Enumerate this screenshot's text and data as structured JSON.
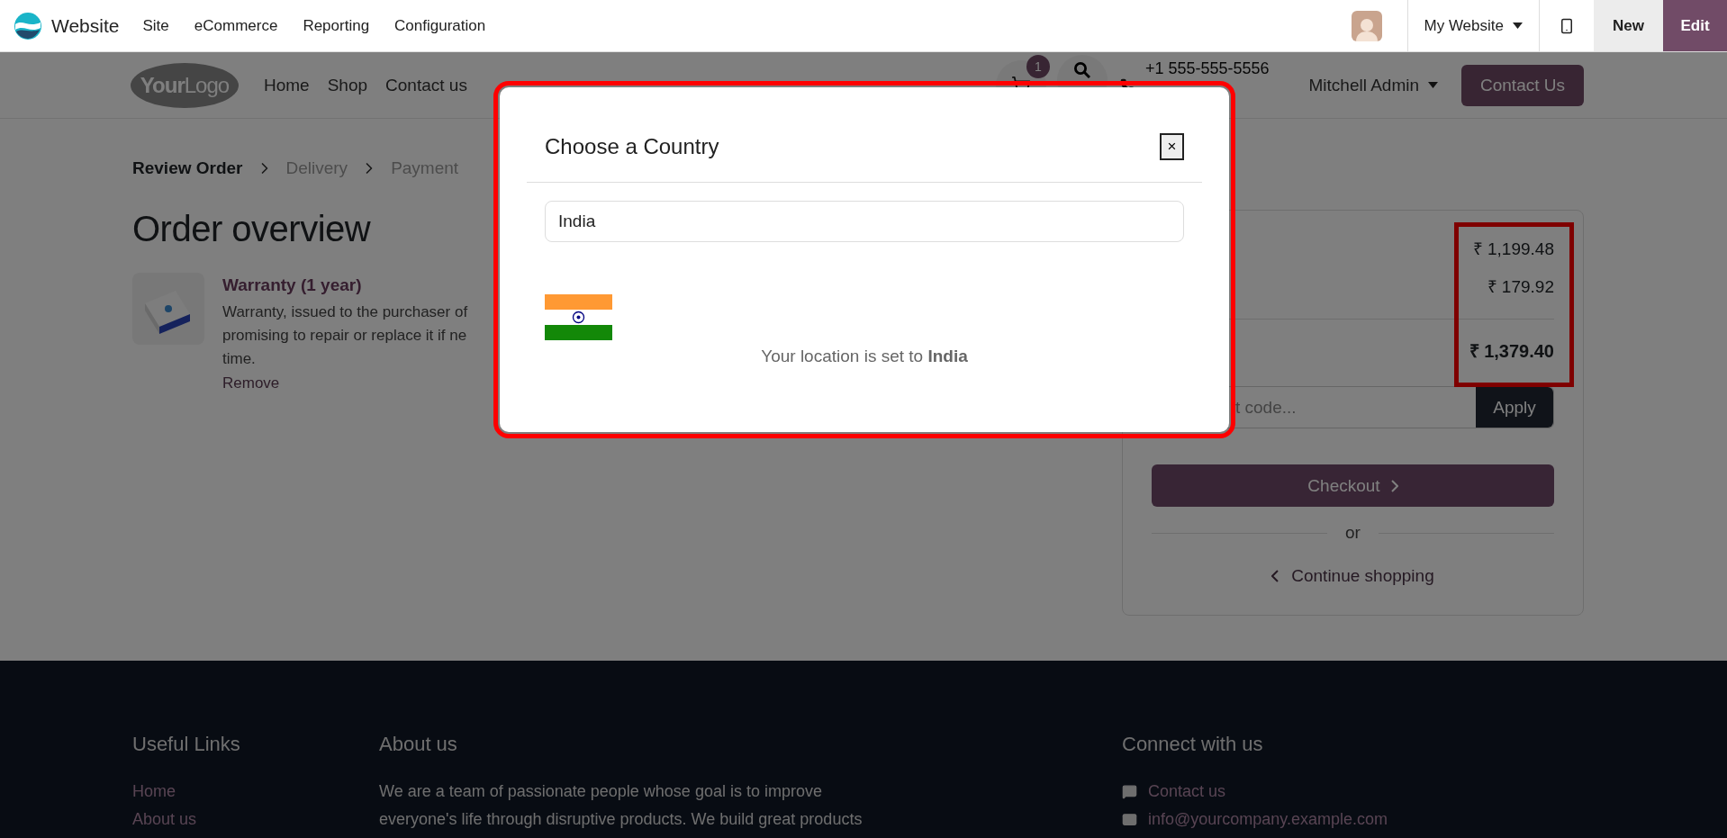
{
  "admin_bar": {
    "app": "Website",
    "menus": [
      "Site",
      "eCommerce",
      "Reporting",
      "Configuration"
    ],
    "website_selector": "My Website",
    "buttons": [
      {
        "label": "New",
        "kind": "new"
      },
      {
        "label": "Edit",
        "kind": "edit"
      }
    ]
  },
  "site_header": {
    "logo": "**Your**Logo",
    "nav": [
      "Home",
      "Shop",
      "Contact us"
    ],
    "cart_count": "1",
    "phone": "+1 555-555-5556",
    "user": "Mitchell Admin",
    "cta": "Contact Us"
  },
  "checkout": {
    "steps": [
      {
        "label": "Review Order",
        "selected": true
      },
      {
        "label": "Delivery",
        "selected": false
      },
      {
        "label": "Payment",
        "selected": false
      }
    ],
    "title": "Order overview",
    "item": {
      "name": "Warranty (1 year)",
      "description_lines": [
        "Warranty, issued to the purchaser of",
        "promising to repair or replace it if ne",
        "time."
      ],
      "remove": "Remove"
    },
    "summary": {
      "highlighted": true,
      "amounts": [
        {
          "value": "₹ 1,199.48",
          "kind": "line"
        },
        {
          "value": "₹ 179.92",
          "kind": "line"
        },
        {
          "value": "₹ 1,379.40",
          "kind": "total"
        }
      ],
      "promo_placeholder": "t code...",
      "apply": "Apply",
      "checkout": "Checkout",
      "or": "or",
      "continue": "Continue shopping"
    }
  },
  "footer": {
    "columns": [
      {
        "title": "Useful Links",
        "kind": "links",
        "links": [
          "Home",
          "About us"
        ]
      },
      {
        "title": "About us",
        "kind": "text",
        "lines": [
          "We are a team of passionate people whose goal is to improve",
          "everyone's life through disruptive products. We build great products"
        ]
      },
      {
        "title": "Connect with us",
        "kind": "contact",
        "contacts": [
          {
            "kind": "chat",
            "label": "Contact us"
          },
          {
            "kind": "mail",
            "label": "info@yourcompany.example.com"
          }
        ]
      }
    ]
  },
  "modal": {
    "title": "Choose a Country",
    "close": "×",
    "search_value": "India",
    "message": "Your location is set to **India**",
    "highlighted": true
  }
}
